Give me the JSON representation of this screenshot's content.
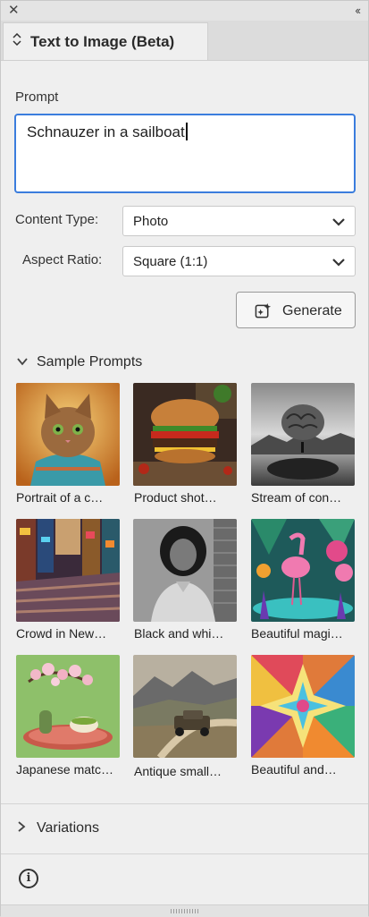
{
  "window": {
    "close_icon": "close-icon",
    "collapse_icon": "double-chevron-left-icon"
  },
  "tab": {
    "title": "Text to Image (Beta)",
    "icon": "up-down-chevron-icon"
  },
  "prompt": {
    "label": "Prompt",
    "value": "Schnauzer in a sailboat"
  },
  "content_type": {
    "label": "Content Type:",
    "value": "Photo"
  },
  "aspect_ratio": {
    "label": "Aspect Ratio:",
    "value": "Square (1:1)"
  },
  "generate": {
    "label": "Generate",
    "icon": "sparkle-image-icon"
  },
  "sample_prompts": {
    "heading": "Sample Prompts",
    "items": [
      {
        "caption": "Portrait of a c…",
        "icon": "kitten-thumbnail"
      },
      {
        "caption": "Product shot…",
        "icon": "burger-thumbnail"
      },
      {
        "caption": "Stream of con…",
        "icon": "brain-landscape-thumbnail"
      },
      {
        "caption": "Crowd in New…",
        "icon": "city-crowd-thumbnail"
      },
      {
        "caption": "Black and whi…",
        "icon": "bw-portrait-thumbnail"
      },
      {
        "caption": "Beautiful magi…",
        "icon": "flamingo-thumbnail"
      },
      {
        "caption": "Japanese matc…",
        "icon": "matcha-thumbnail"
      },
      {
        "caption": "Antique small…",
        "icon": "antique-car-thumbnail"
      },
      {
        "caption": "Beautiful and…",
        "icon": "origami-star-thumbnail"
      }
    ]
  },
  "variations": {
    "heading": "Variations"
  },
  "footer": {
    "info_icon": "info-icon",
    "info_glyph": "i"
  },
  "colors": {
    "accent": "#3b7ddd",
    "panel_bg": "#efefef"
  }
}
